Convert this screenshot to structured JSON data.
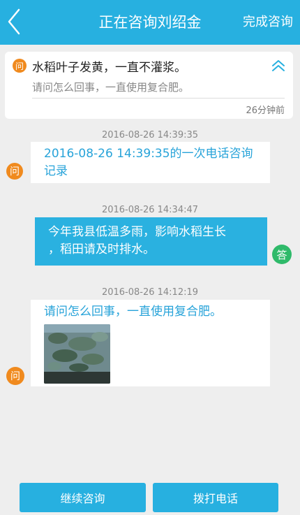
{
  "header": {
    "title": "正在咨询刘绍金",
    "finish_label": "完成咨询"
  },
  "question": {
    "badge": "问",
    "title": "水稻叶子发黄，一直不灌浆。",
    "description": "请问怎么回事，一直使用复合肥。",
    "time_ago": "26分钟前"
  },
  "messages": [
    {
      "timestamp": "2016-08-26 14:39:35",
      "role_badge": "问",
      "text": "2016-08-26 14:39:35的一次电话咨询记录"
    },
    {
      "timestamp": "2016-08-26 14:34:47",
      "role_badge": "答",
      "text_line1": "今年我县低温多雨，影响水稻生长",
      "text_line2": "，稻田请及时排水。"
    },
    {
      "timestamp": "2016-08-26 14:12:19",
      "role_badge": "问",
      "text": "请问怎么回事，一直使用复合肥。"
    }
  ],
  "footer": {
    "continue_label": "继续咨询",
    "call_label": "拨打电话"
  },
  "colors": {
    "brand": "#27b0e0",
    "question_badge": "#f08a1e",
    "answer_badge": "#2fba6a"
  },
  "icons": {
    "back": "chevron-left-icon",
    "collapse": "double-chevron-up-icon"
  }
}
